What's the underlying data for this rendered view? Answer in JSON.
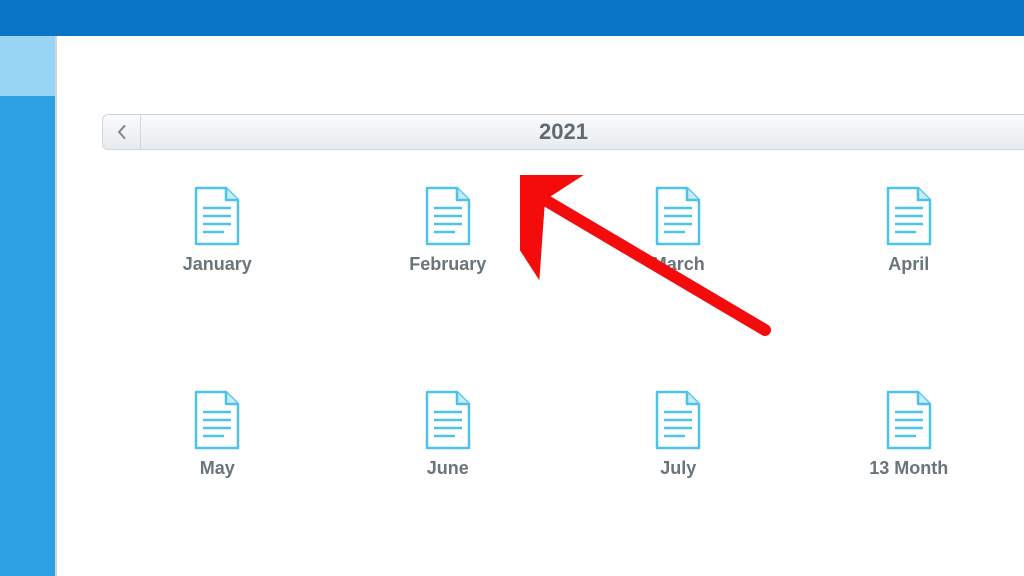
{
  "navigation": {
    "title": "2021"
  },
  "files": [
    {
      "label": "January"
    },
    {
      "label": "February"
    },
    {
      "label": "March"
    },
    {
      "label": "April"
    },
    {
      "label": "May"
    },
    {
      "label": "June"
    },
    {
      "label": "July"
    },
    {
      "label": "13 Month"
    }
  ],
  "colors": {
    "titlebar": "#0a74c5",
    "side_light": "#98d5f5",
    "side_blue": "#2ca0e2",
    "icon_fill": "#ffffff",
    "icon_stroke": "#4dc3e8",
    "annotation": "#f40b0b"
  }
}
